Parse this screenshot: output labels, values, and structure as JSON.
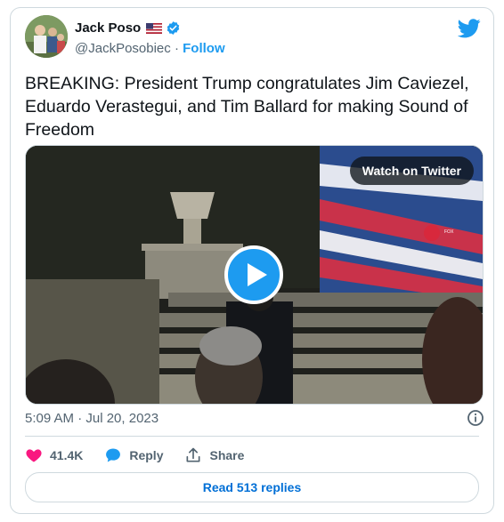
{
  "author": {
    "name": "Jack Poso",
    "flag_emoji": "🇺🇸",
    "handle": "@JackPosobiec",
    "separator": "·",
    "follow_label": "Follow"
  },
  "tweet": {
    "text": "BREAKING: President Trump congratulates Jim Caviezel, Eduardo Verastegui, and Tim Ballard for making Sound of Freedom",
    "timestamp": "5:09 AM · Jul 20, 2023"
  },
  "media": {
    "watch_label": "Watch on Twitter",
    "screen_logo_text": "FOX"
  },
  "actions": {
    "likes": "41.4K",
    "reply_label": "Reply",
    "share_label": "Share"
  },
  "replies_button": "Read 513 replies",
  "colors": {
    "accent": "#1d9bf0",
    "like": "#f91880",
    "link": "#006fd6",
    "muted": "#536471"
  },
  "icons": [
    "avatar",
    "flag-us-icon",
    "verified-badge-icon",
    "twitter-bird-icon",
    "play-icon",
    "info-icon",
    "heart-icon",
    "reply-bubble-icon",
    "share-icon"
  ]
}
